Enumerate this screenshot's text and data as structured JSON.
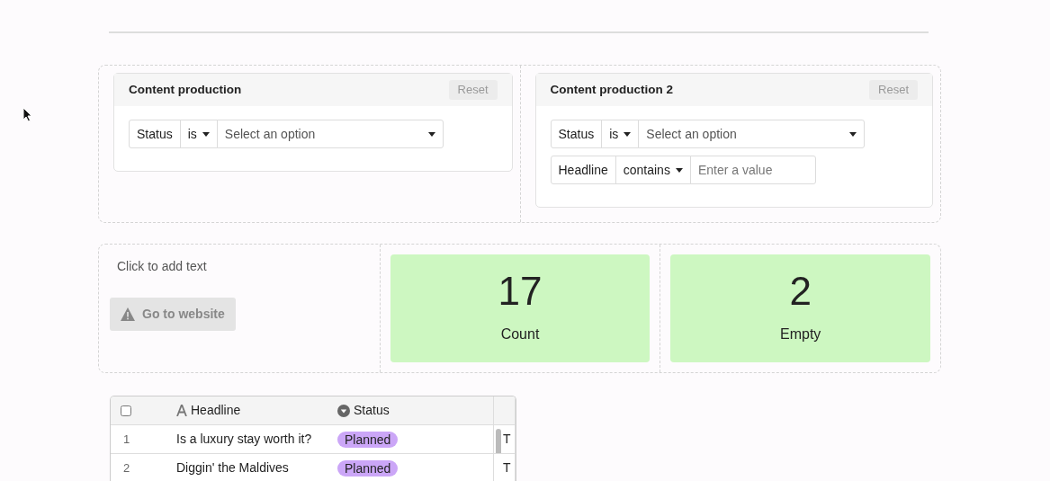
{
  "filter_panels": [
    {
      "title": "Content production",
      "reset": "Reset",
      "filters": [
        {
          "field": "Status",
          "operator": "is",
          "kind": "select",
          "placeholder": "Select an option"
        }
      ]
    },
    {
      "title": "Content production 2",
      "reset": "Reset",
      "filters": [
        {
          "field": "Status",
          "operator": "is",
          "kind": "select",
          "placeholder": "Select an option"
        },
        {
          "field": "Headline",
          "operator": "contains",
          "kind": "text",
          "placeholder": "Enter a value"
        }
      ]
    }
  ],
  "text_block": {
    "placeholder": "Click to add text",
    "button": {
      "label": "Go to website",
      "disabled": true
    }
  },
  "metrics": [
    {
      "value": "17",
      "label": "Count",
      "color": "#cdf7c1"
    },
    {
      "value": "2",
      "label": "Empty",
      "color": "#cdf7c1"
    }
  ],
  "table": {
    "select_all": {
      "checked": false
    },
    "columns": [
      {
        "label": "Headline",
        "kind": "text"
      },
      {
        "label": "Status",
        "kind": "select"
      }
    ],
    "rows": [
      {
        "number": "1",
        "headline": "Is a luxury stay worth it?",
        "status": "Planned",
        "color": "#cba6f7",
        "column_3": "T"
      },
      {
        "number": "2",
        "headline": "Diggin' the Maldives",
        "status": "Planned",
        "color": "#cba6f7",
        "column_3": "T"
      }
    ]
  }
}
